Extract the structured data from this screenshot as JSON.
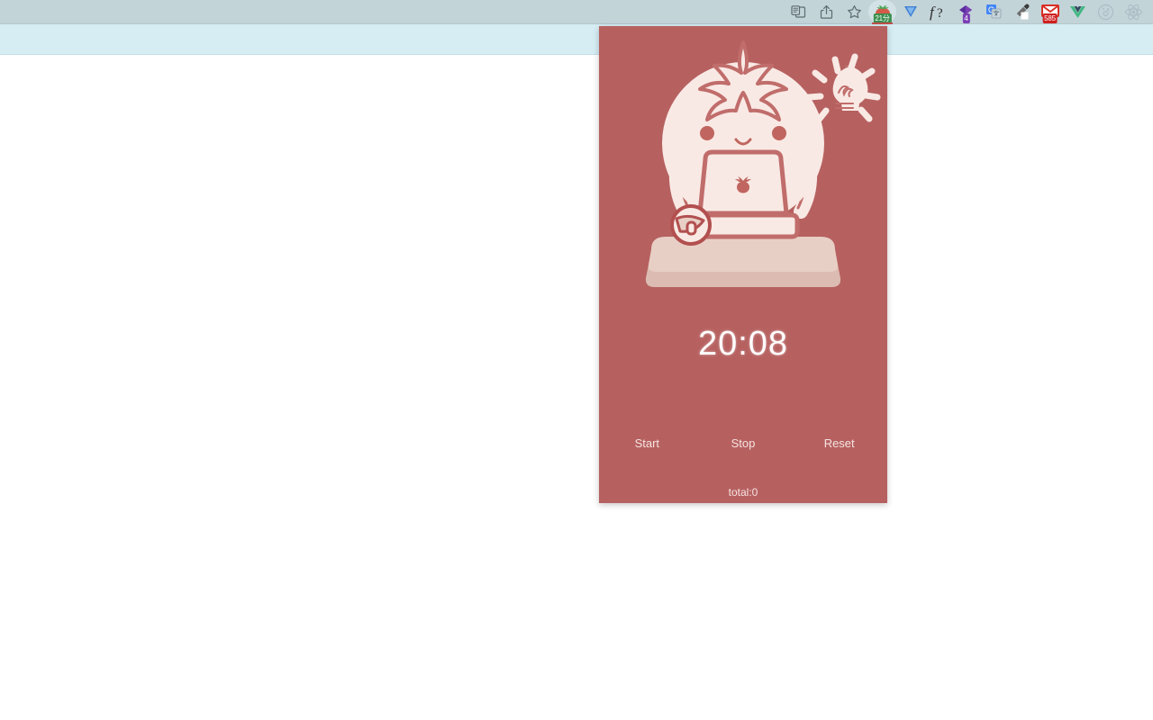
{
  "browser": {
    "toolbar_icons": [
      {
        "name": "reader-translate-icon",
        "glyph": "reader"
      },
      {
        "name": "share-icon",
        "glyph": "share"
      },
      {
        "name": "bookmark-star-icon",
        "glyph": "star"
      },
      {
        "name": "tomato-timer-extension-icon",
        "glyph": "tomato",
        "badge": "21分",
        "badge_color": "#3a8f4e",
        "active": true
      },
      {
        "name": "vimium-extension-icon",
        "glyph": "v-blue"
      },
      {
        "name": "function-extension-icon",
        "glyph": "f-question"
      },
      {
        "name": "diamond-extension-icon",
        "glyph": "diamond",
        "badge": "4",
        "badge_color": "#7b3fb5"
      },
      {
        "name": "google-translate-extension-icon",
        "glyph": "g-translate"
      },
      {
        "name": "color-picker-extension-icon",
        "glyph": "eyedropper"
      },
      {
        "name": "gmail-extension-icon",
        "glyph": "gmail",
        "badge": "585",
        "badge_color": "#cf2020"
      },
      {
        "name": "vue-devtools-extension-icon",
        "glyph": "vue"
      },
      {
        "name": "disabled-extension-icon",
        "glyph": "circle-dots"
      },
      {
        "name": "react-devtools-extension-icon",
        "glyph": "react"
      }
    ],
    "colors": {
      "toolbar_bg": "#c3d4d9",
      "tabstrip_bg": "#d6edf4",
      "page_bg": "#ffffff"
    }
  },
  "popup": {
    "background_color": "#b66160",
    "illustration": {
      "name": "tomato-character-at-laptop",
      "body_color": "#f9e9e4",
      "outline_color": "#c06d6b",
      "desk_color": "#e8cfc6",
      "desk_shadow_color": "#dcbcb2",
      "elements": [
        "tomato-head",
        "leaf-crown",
        "eyes",
        "smile",
        "arms",
        "laptop",
        "tomato-logo",
        "mouse",
        "desk",
        "lightbulb-idea"
      ]
    },
    "timer": {
      "label": "countdown-timer",
      "value": "20:08",
      "color": "#ffffff"
    },
    "controls": [
      {
        "name": "start-button",
        "label": "Start"
      },
      {
        "name": "stop-button",
        "label": "Stop"
      },
      {
        "name": "reset-button",
        "label": "Reset"
      }
    ],
    "total": {
      "label": "total:0"
    }
  }
}
